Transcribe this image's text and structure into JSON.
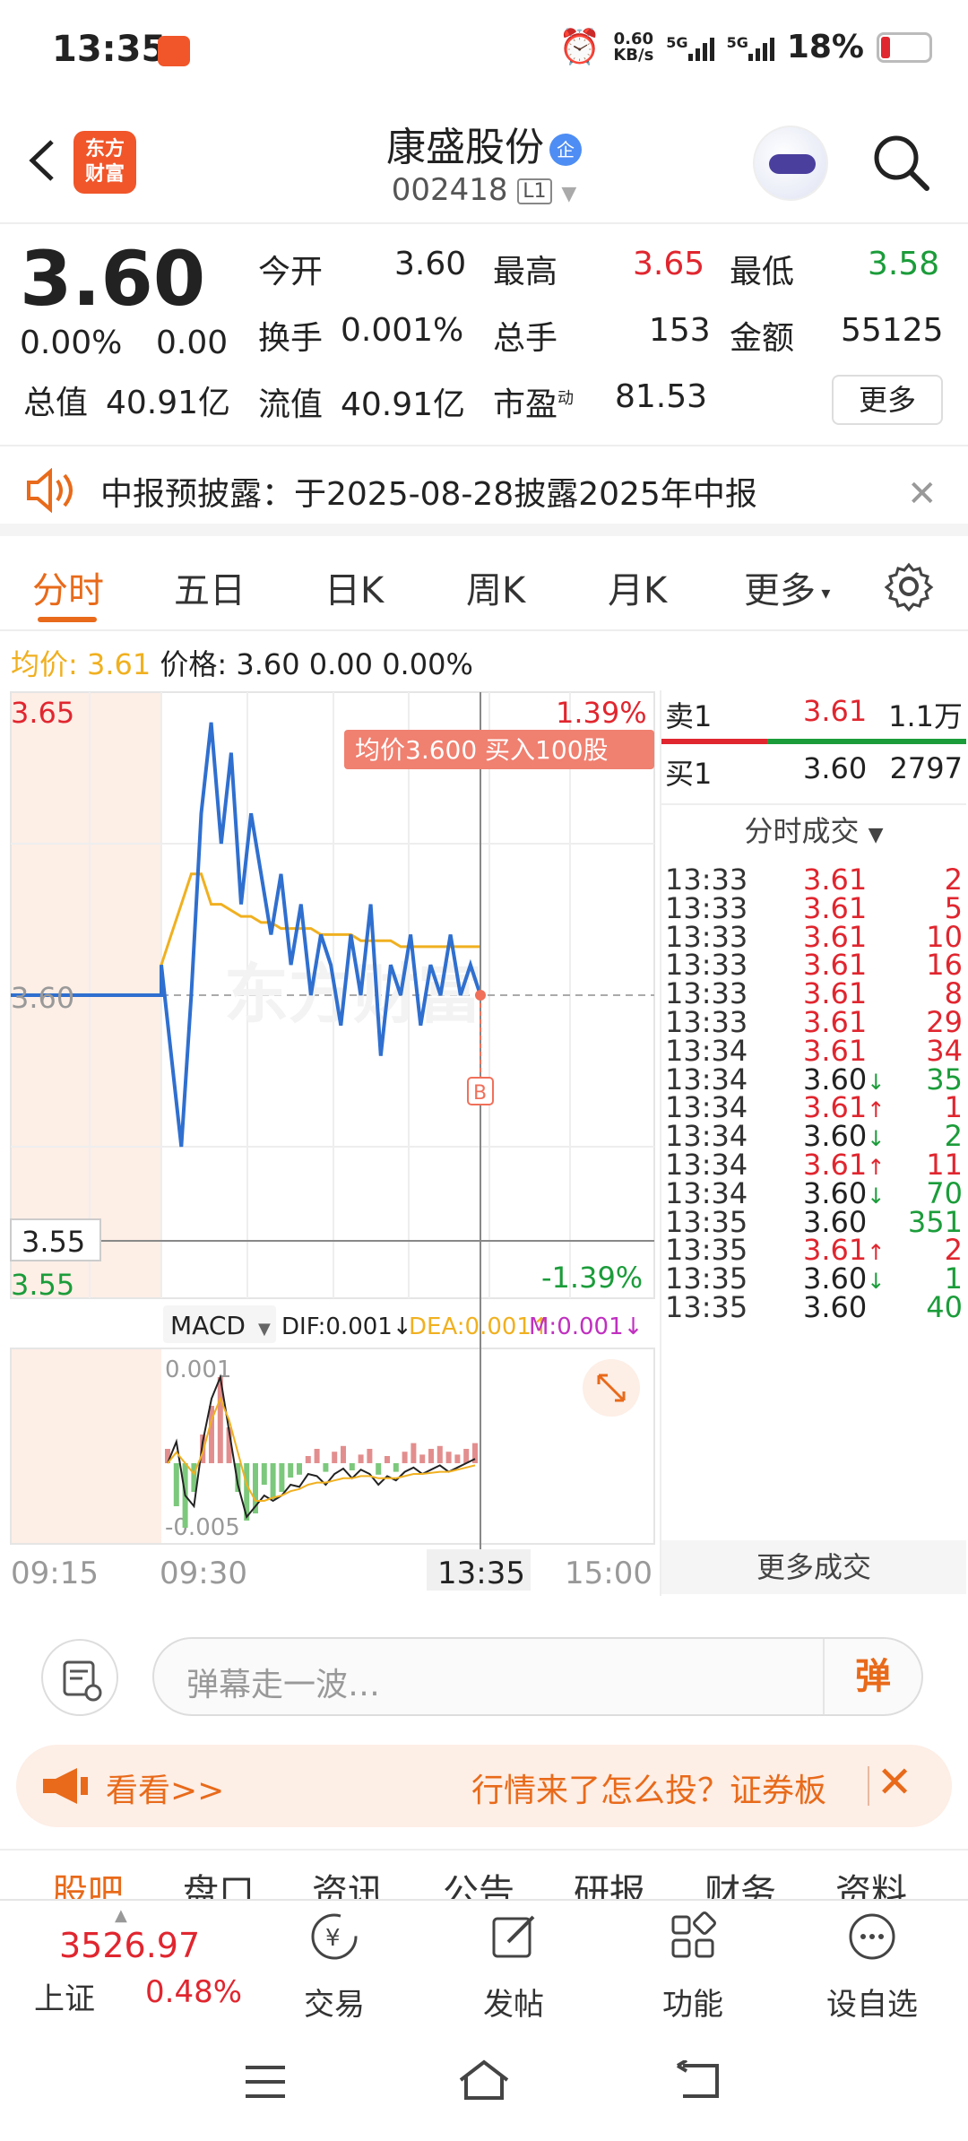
{
  "status_bar": {
    "time": "13:35",
    "net_speed_top": "0.60",
    "net_speed_unit": "KB/s",
    "sig1": "5G",
    "sig2": "5G",
    "battery": "18%"
  },
  "header": {
    "logo_line1": "东方",
    "logo_line2": "财富",
    "stock_name": "康盛股份",
    "badge": "企",
    "code": "002418",
    "level": "L1"
  },
  "quote": {
    "price": "3.60",
    "change_pct": "0.00%",
    "change": "0.00",
    "open_label": "今开",
    "open": "3.60",
    "high_label": "最高",
    "high": "3.65",
    "low_label": "最低",
    "low": "3.58",
    "turnover_label": "换手",
    "turnover": "0.001%",
    "volume_label": "总手",
    "volume": "153",
    "amount_label": "金额",
    "amount": "55125",
    "mktcap_label": "总值",
    "mktcap": "40.91亿",
    "float_label": "流值",
    "float": "40.91亿",
    "pe_label": "市盈",
    "pe_sup": "动",
    "pe": "81.53",
    "more": "更多"
  },
  "notice": {
    "text": "中报预披露：于2025-08-28披露2025年中报"
  },
  "tabs": [
    "分时",
    "五日",
    "日K",
    "周K",
    "月K",
    "更多"
  ],
  "info_line": {
    "avg_label": "均价:",
    "avg": "3.61",
    "price_text": "价格: 3.60  0.00  0.00%"
  },
  "chart": {
    "y_top": "3.65",
    "y_mid": "3.60",
    "y_bot": "3.55",
    "y_cursor": "3.55",
    "pct_top": "1.39%",
    "pct_bot": "-1.39%",
    "tooltip": "均价3.600   买入100股",
    "b_marker": "B",
    "watermark": "东方财富",
    "macd_label": "MACD",
    "dif": "DIF:0.001↓",
    "dea": "DEA:0.001↑",
    "m": "M:0.001↓",
    "macd_top": "0.001",
    "macd_bot": "-0.005",
    "t_start": "09:15",
    "t_open": "09:30",
    "t_cursor": "13:35",
    "t_end": "15:00"
  },
  "chart_data": {
    "type": "line",
    "title": "",
    "ylim": [
      3.55,
      3.65
    ],
    "series": [
      {
        "values": [
          3.6,
          3.6,
          3.6,
          3.6,
          3.6,
          3.6,
          3.6,
          3.605,
          3.59,
          3.575,
          3.6,
          3.63,
          3.645,
          3.625,
          3.64,
          3.615,
          3.63,
          3.62,
          3.61,
          3.62,
          3.605,
          3.615,
          3.6,
          3.61,
          3.605,
          3.595,
          3.61,
          3.6,
          3.615,
          3.59,
          3.605,
          3.6,
          3.61,
          3.595,
          3.605,
          3.6,
          3.61,
          3.6,
          3.605,
          3.6
        ]
      },
      {
        "values": [
          3.6,
          3.6,
          3.6,
          3.6,
          3.6,
          3.6,
          3.6,
          3.605,
          3.61,
          3.615,
          3.62,
          3.62,
          3.615,
          3.615,
          3.614,
          3.613,
          3.613,
          3.612,
          3.612,
          3.611,
          3.611,
          3.611,
          3.611,
          3.61,
          3.61,
          3.61,
          3.61,
          3.609,
          3.609,
          3.609,
          3.609,
          3.608,
          3.608,
          3.608,
          3.608,
          3.608,
          3.608,
          3.608,
          3.608,
          3.608
        ]
      }
    ]
  },
  "order_book": {
    "sell_label": "卖1",
    "sell_price": "3.61",
    "sell_vol": "1.1万",
    "buy_label": "买1",
    "buy_price": "3.60",
    "buy_vol": "2797",
    "trades_title": "分时成交",
    "trades": [
      {
        "t": "13:33",
        "p": "3.61",
        "v": "2",
        "c": "red",
        "a": ""
      },
      {
        "t": "13:33",
        "p": "3.61",
        "v": "5",
        "c": "red",
        "a": ""
      },
      {
        "t": "13:33",
        "p": "3.61",
        "v": "10",
        "c": "red",
        "a": ""
      },
      {
        "t": "13:33",
        "p": "3.61",
        "v": "16",
        "c": "red",
        "a": ""
      },
      {
        "t": "13:33",
        "p": "3.61",
        "v": "8",
        "c": "red",
        "a": ""
      },
      {
        "t": "13:33",
        "p": "3.61",
        "v": "29",
        "c": "red",
        "a": ""
      },
      {
        "t": "13:34",
        "p": "3.61",
        "v": "34",
        "c": "red",
        "a": ""
      },
      {
        "t": "13:34",
        "p": "3.60",
        "v": "35",
        "c": "green",
        "a": "↓"
      },
      {
        "t": "13:34",
        "p": "3.61",
        "v": "1",
        "c": "red",
        "a": "↑"
      },
      {
        "t": "13:34",
        "p": "3.60",
        "v": "2",
        "c": "green",
        "a": "↓"
      },
      {
        "t": "13:34",
        "p": "3.61",
        "v": "11",
        "c": "red",
        "a": "↑"
      },
      {
        "t": "13:34",
        "p": "3.60",
        "v": "70",
        "c": "green",
        "a": "↓"
      },
      {
        "t": "13:35",
        "p": "3.60",
        "v": "351",
        "c": "green",
        "a": ""
      },
      {
        "t": "13:35",
        "p": "3.61",
        "v": "2",
        "c": "red",
        "a": "↑"
      },
      {
        "t": "13:35",
        "p": "3.60",
        "v": "1",
        "c": "green",
        "a": "↓"
      },
      {
        "t": "13:35",
        "p": "3.60",
        "v": "40",
        "c": "green",
        "a": ""
      }
    ],
    "more": "更多成交"
  },
  "comment": {
    "placeholder": "弹幕走一波…",
    "dan": "弹"
  },
  "promo": {
    "left": "看看>>",
    "right": "行情来了怎么投？证券板"
  },
  "subtabs": [
    "股吧",
    "盘口",
    "资讯",
    "公告",
    "研报",
    "财务",
    "资料"
  ],
  "bottom_nav": {
    "index_value": "3526.97",
    "index_name": "上证",
    "index_pct": "0.48%",
    "items": [
      "交易",
      "发帖",
      "功能",
      "设自选"
    ]
  }
}
